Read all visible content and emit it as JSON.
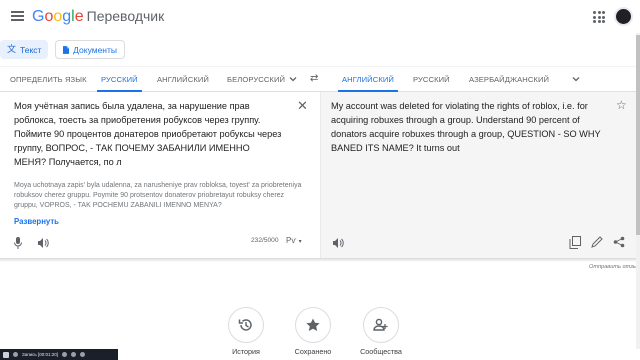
{
  "header": {
    "logo_parts": [
      "G",
      "o",
      "o",
      "g",
      "l",
      "e"
    ],
    "product": "Переводчик"
  },
  "modes": {
    "text_label": "Текст",
    "docs_label": "Документы"
  },
  "source_langs": [
    "ОПРЕДЕЛИТЬ ЯЗЫК",
    "РУССКИЙ",
    "АНГЛИЙСКИЙ",
    "БЕЛОРУССКИЙ"
  ],
  "source_active": "РУССКИЙ",
  "target_langs": [
    "АНГЛИЙСКИЙ",
    "РУССКИЙ",
    "АЗЕРБАЙДЖАНСКИЙ"
  ],
  "target_active": "АНГЛИЙСКИЙ",
  "source": {
    "text": "Моя учётная запись была удалена, за нарушение прав роблокса, тоесть за приобретения робуксов через группу. Поймите 90 процентов донатеров приобретают робуксы через группу, ВОПРОС, - ТАК ПОЧЕМУ ЗАБАНИЛИ ИМЕННО МЕНЯ? Получается, по л",
    "transliteration": "Moya uchotnaya zapis' byla udalenna, za narusheniye prav robloksa, toyest' za priobreteniya robuksov cherez gruppu. Poymite 90 protsentov donaterov priobretayut robuksy cherez gruppu, VOPROS, - TAK POCHEMU ZABANILI IMENNO MENYA?",
    "expand_label": "Развернуть",
    "counter": "232/5000",
    "keyboard_label": "Рѵ"
  },
  "target": {
    "text": "My account was deleted for violating the rights of roblox, i.e. for acquiring robuxes through a group. Understand 90 percent of donators acquire robuxes through a group, QUESTION - SO WHY BANED ITS NAME? It turns out"
  },
  "feedback_label": "Отправить отзыв",
  "actions": [
    {
      "label": "История",
      "icon": "history-icon"
    },
    {
      "label": "Сохранено",
      "icon": "star-icon"
    },
    {
      "label": "Сообщества",
      "icon": "community-icon"
    }
  ],
  "taskbar": {
    "text": "Запись [00:01:20]"
  },
  "colors": {
    "accent": "#1a73e8",
    "target_bg": "#f5f5f5",
    "mode_active_bg": "#e8f0fe"
  }
}
